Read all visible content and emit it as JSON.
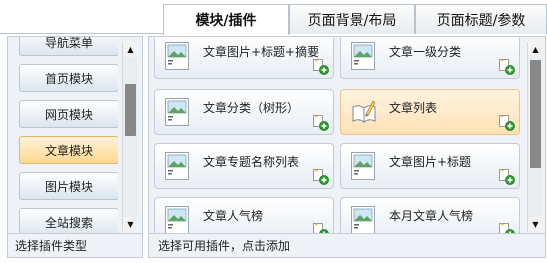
{
  "tabs": [
    {
      "label": "模块/插件",
      "active": true
    },
    {
      "label": "页面背景/布局",
      "active": false
    },
    {
      "label": "页面标题/参数",
      "active": false
    }
  ],
  "left_panel": {
    "categories": [
      {
        "label": "导航菜单",
        "active": false
      },
      {
        "label": "首页模块",
        "active": false
      },
      {
        "label": "网页模块",
        "active": false
      },
      {
        "label": "文章模块",
        "active": true
      },
      {
        "label": "图片模块",
        "active": false
      },
      {
        "label": "全站搜索",
        "active": false
      }
    ],
    "footer_text": "选择插件类型"
  },
  "right_panel": {
    "plugins": [
      {
        "label": "文章图片+标题+摘要",
        "icon": "image-thumb-icon",
        "active": false
      },
      {
        "label": "文章一级分类",
        "icon": "image-thumb-icon",
        "active": false
      },
      {
        "label": "文章分类（树形）",
        "icon": "image-thumb-icon",
        "active": false
      },
      {
        "label": "文章列表",
        "icon": "open-book-icon",
        "active": true
      },
      {
        "label": "文章专题名称列表",
        "icon": "image-thumb-icon",
        "active": false
      },
      {
        "label": "文章图片+标题",
        "icon": "image-thumb-icon",
        "active": false
      },
      {
        "label": "文章人气榜",
        "icon": "image-thumb-icon",
        "active": false
      },
      {
        "label": "本月文章人气榜",
        "icon": "image-thumb-icon",
        "active": false
      }
    ],
    "footer_text": "选择可用插件，点击添加"
  },
  "colors": {
    "active_tile": "#ffe1b5",
    "active_category": "#ffd88f",
    "panel_bg": "#eef2f6",
    "border": "#c5ccd4",
    "add_icon_green": "#2e9e2e"
  }
}
